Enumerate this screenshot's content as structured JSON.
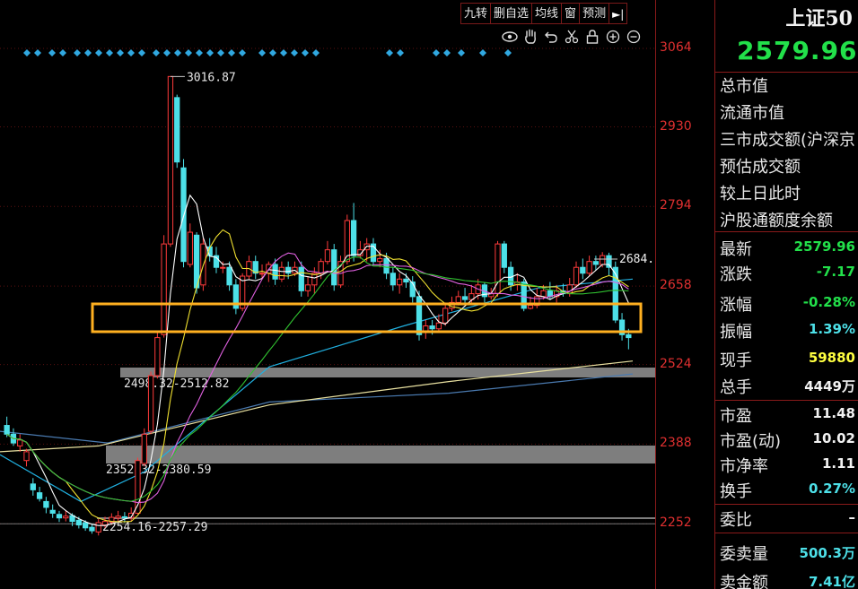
{
  "toolbar": {
    "buttons": [
      "九转",
      "删自选",
      "均线",
      "窗",
      "预测"
    ],
    "arrow": "►|"
  },
  "tools": [
    "eye-icon",
    "hand-icon",
    "undo-icon",
    "scissors-icon",
    "lock-icon",
    "zoom-in-icon",
    "zoom-out-icon"
  ],
  "price_axis": {
    "ticks": [
      "3064",
      "2930",
      "2794",
      "2658",
      "2524",
      "2388",
      "2252"
    ]
  },
  "annotations": {
    "high": "3016.87",
    "last_close_tag": "2684.",
    "zone_upper": "2498.32-2512.82",
    "zone_middle": "2352.32-2380.59",
    "zone_lower": "2254.16-2257.29"
  },
  "colors": {
    "up": "#ff3b3b",
    "down": "#4de0e8",
    "highlight_box": "#ffb020",
    "zone_fill": "#8c8c8c",
    "ma5": "#ffffff",
    "ma10": "#f0e030",
    "ma20": "#e060e0",
    "ma30": "#30c030",
    "ma60": "#20b0e0",
    "ma120": "#e8e0a0",
    "ma250": "#4a7ab0"
  },
  "chart_data": {
    "type": "candlestick",
    "title": "",
    "ylim": [
      2200,
      3110
    ],
    "y_ticks": [
      3064,
      2930,
      2794,
      2658,
      2524,
      2388,
      2252
    ],
    "candles": [
      [
        2420,
        2405,
        2435,
        2400
      ],
      [
        2405,
        2390,
        2415,
        2385
      ],
      [
        2385,
        2395,
        2405,
        2375
      ],
      [
        2360,
        2375,
        2380,
        2350
      ],
      [
        2320,
        2310,
        2330,
        2300
      ],
      [
        2305,
        2295,
        2315,
        2290
      ],
      [
        2290,
        2280,
        2298,
        2270
      ],
      [
        2275,
        2270,
        2285,
        2262
      ],
      [
        2268,
        2262,
        2274,
        2255
      ],
      [
        2262,
        2265,
        2274,
        2256
      ],
      [
        2266,
        2256,
        2270,
        2248
      ],
      [
        2258,
        2250,
        2264,
        2244
      ],
      [
        2254,
        2245,
        2258,
        2240
      ],
      [
        2246,
        2240,
        2252,
        2235
      ],
      [
        2238,
        2254,
        2260,
        2232
      ],
      [
        2250,
        2256,
        2264,
        2245
      ],
      [
        2255,
        2263,
        2270,
        2250
      ],
      [
        2262,
        2265,
        2274,
        2255
      ],
      [
        2264,
        2262,
        2272,
        2254
      ],
      [
        2262,
        2270,
        2280,
        2257
      ],
      [
        2270,
        2360,
        2365,
        2268
      ],
      [
        2355,
        2405,
        2415,
        2350
      ],
      [
        2410,
        2505,
        2512,
        2405
      ],
      [
        2505,
        2570,
        2578,
        2500
      ],
      [
        2575,
        2730,
        2745,
        2570
      ],
      [
        2730,
        3016,
        3016,
        2725
      ],
      [
        2980,
        2870,
        2985,
        2860
      ],
      [
        2860,
        2700,
        2875,
        2690
      ],
      [
        2695,
        2750,
        2765,
        2690
      ],
      [
        2745,
        2655,
        2750,
        2645
      ],
      [
        2660,
        2730,
        2740,
        2650
      ],
      [
        2725,
        2710,
        2740,
        2700
      ],
      [
        2710,
        2690,
        2725,
        2680
      ],
      [
        2690,
        2690,
        2700,
        2680
      ],
      [
        2690,
        2660,
        2700,
        2650
      ],
      [
        2660,
        2620,
        2670,
        2610
      ],
      [
        2620,
        2675,
        2680,
        2615
      ],
      [
        2675,
        2700,
        2710,
        2670
      ],
      [
        2700,
        2680,
        2710,
        2670
      ],
      [
        2680,
        2680,
        2695,
        2670
      ],
      [
        2680,
        2695,
        2700,
        2665
      ],
      [
        2695,
        2670,
        2705,
        2660
      ],
      [
        2670,
        2690,
        2700,
        2665
      ],
      [
        2690,
        2680,
        2700,
        2670
      ],
      [
        2680,
        2690,
        2700,
        2675
      ],
      [
        2690,
        2650,
        2700,
        2640
      ],
      [
        2650,
        2660,
        2675,
        2640
      ],
      [
        2660,
        2680,
        2690,
        2645
      ],
      [
        2680,
        2700,
        2705,
        2670
      ],
      [
        2700,
        2720,
        2735,
        2695
      ],
      [
        2720,
        2660,
        2730,
        2650
      ],
      [
        2660,
        2700,
        2710,
        2655
      ],
      [
        2700,
        2770,
        2780,
        2695
      ],
      [
        2770,
        2710,
        2800,
        2700
      ],
      [
        2710,
        2720,
        2735,
        2705
      ],
      [
        2720,
        2730,
        2740,
        2700
      ],
      [
        2730,
        2700,
        2740,
        2695
      ],
      [
        2700,
        2705,
        2720,
        2690
      ],
      [
        2705,
        2680,
        2715,
        2670
      ],
      [
        2680,
        2660,
        2690,
        2650
      ],
      [
        2660,
        2670,
        2680,
        2645
      ],
      [
        2670,
        2665,
        2680,
        2655
      ],
      [
        2665,
        2640,
        2675,
        2630
      ],
      [
        2640,
        2575,
        2650,
        2565
      ],
      [
        2580,
        2590,
        2600,
        2568
      ],
      [
        2590,
        2585,
        2600,
        2575
      ],
      [
        2585,
        2595,
        2610,
        2580
      ],
      [
        2595,
        2620,
        2630,
        2590
      ],
      [
        2620,
        2630,
        2640,
        2615
      ],
      [
        2630,
        2640,
        2650,
        2625
      ],
      [
        2640,
        2635,
        2655,
        2625
      ],
      [
        2635,
        2645,
        2660,
        2630
      ],
      [
        2645,
        2660,
        2670,
        2635
      ],
      [
        2660,
        2640,
        2665,
        2630
      ],
      [
        2640,
        2645,
        2655,
        2635
      ],
      [
        2645,
        2730,
        2735,
        2640
      ],
      [
        2730,
        2690,
        2735,
        2680
      ],
      [
        2690,
        2660,
        2700,
        2650
      ],
      [
        2660,
        2665,
        2680,
        2650
      ],
      [
        2665,
        2620,
        2670,
        2615
      ],
      [
        2620,
        2625,
        2640,
        2618
      ],
      [
        2625,
        2640,
        2655,
        2620
      ],
      [
        2640,
        2650,
        2660,
        2635
      ],
      [
        2650,
        2640,
        2665,
        2635
      ],
      [
        2640,
        2650,
        2660,
        2630
      ],
      [
        2650,
        2645,
        2662,
        2640
      ],
      [
        2645,
        2660,
        2672,
        2640
      ],
      [
        2660,
        2690,
        2700,
        2655
      ],
      [
        2690,
        2680,
        2705,
        2670
      ],
      [
        2680,
        2700,
        2710,
        2675
      ],
      [
        2700,
        2695,
        2710,
        2685
      ],
      [
        2695,
        2710,
        2716,
        2690
      ],
      [
        2710,
        2690,
        2715,
        2675
      ],
      [
        2690,
        2600,
        2700,
        2595
      ],
      [
        2600,
        2575,
        2612,
        2565
      ],
      [
        2575,
        2570,
        2585,
        2550
      ]
    ],
    "ma_lines": {
      "ma250": [
        [
          0,
          2410
        ],
        [
          120,
          2390
        ],
        [
          300,
          2460
        ],
        [
          500,
          2475
        ],
        [
          705,
          2508
        ]
      ],
      "ma120": [
        [
          0,
          2375
        ],
        [
          110,
          2385
        ],
        [
          300,
          2455
        ],
        [
          500,
          2495
        ],
        [
          705,
          2530
        ]
      ],
      "ma60": [
        [
          0,
          2370
        ],
        [
          90,
          2290
        ],
        [
          160,
          2340
        ],
        [
          300,
          2520
        ],
        [
          450,
          2590
        ],
        [
          600,
          2655
        ],
        [
          705,
          2670
        ]
      ]
    },
    "zones": [
      {
        "label": "2498.32-2512.82",
        "low": 2498.32,
        "high": 2512.82
      },
      {
        "label": "2352.32-2380.59",
        "low": 2352.32,
        "high": 2380.59
      },
      {
        "label": "2254.16-2257.29",
        "low": 2254.16,
        "high": 2257.29
      }
    ],
    "highlight": {
      "low": 2550,
      "high": 2600
    }
  },
  "panel": {
    "index_name": "上证50",
    "index_price": "2579.96",
    "info_rows": [
      "总市值",
      "流通市值",
      "三市成交额(沪深京",
      "预估成交额",
      "较上日此时",
      "沪股通额度余额"
    ],
    "stats": [
      {
        "label": "最新",
        "value": "2579.96",
        "color": "#22e04a"
      },
      {
        "label": "涨跌",
        "value": "-7.17",
        "color": "#22e04a"
      },
      {
        "label": "涨幅",
        "value": "-0.28%",
        "color": "#22e04a"
      },
      {
        "label": "振幅",
        "value": "1.39%",
        "color": "#4de0e8"
      },
      {
        "label": "现手",
        "value": "59880",
        "color": "#ffff40"
      },
      {
        "label": "总手",
        "value": "4449万",
        "color": "#f2f2f2"
      },
      {
        "label": "市盈",
        "value": "11.48",
        "color": "#f2f2f2"
      },
      {
        "label": "市盈(动)",
        "value": "10.02",
        "color": "#f2f2f2"
      },
      {
        "label": "市净率",
        "value": "1.11",
        "color": "#f2f2f2"
      },
      {
        "label": "换手",
        "value": "0.27%",
        "color": "#4de0e8"
      },
      {
        "label": "委比",
        "value": "–",
        "color": "#f2f2f2"
      },
      {
        "label": "委卖量",
        "value": "500.3万",
        "color": "#4de0e8"
      },
      {
        "label": "卖金额",
        "value": "7.41亿",
        "color": "#4de0e8"
      }
    ]
  }
}
